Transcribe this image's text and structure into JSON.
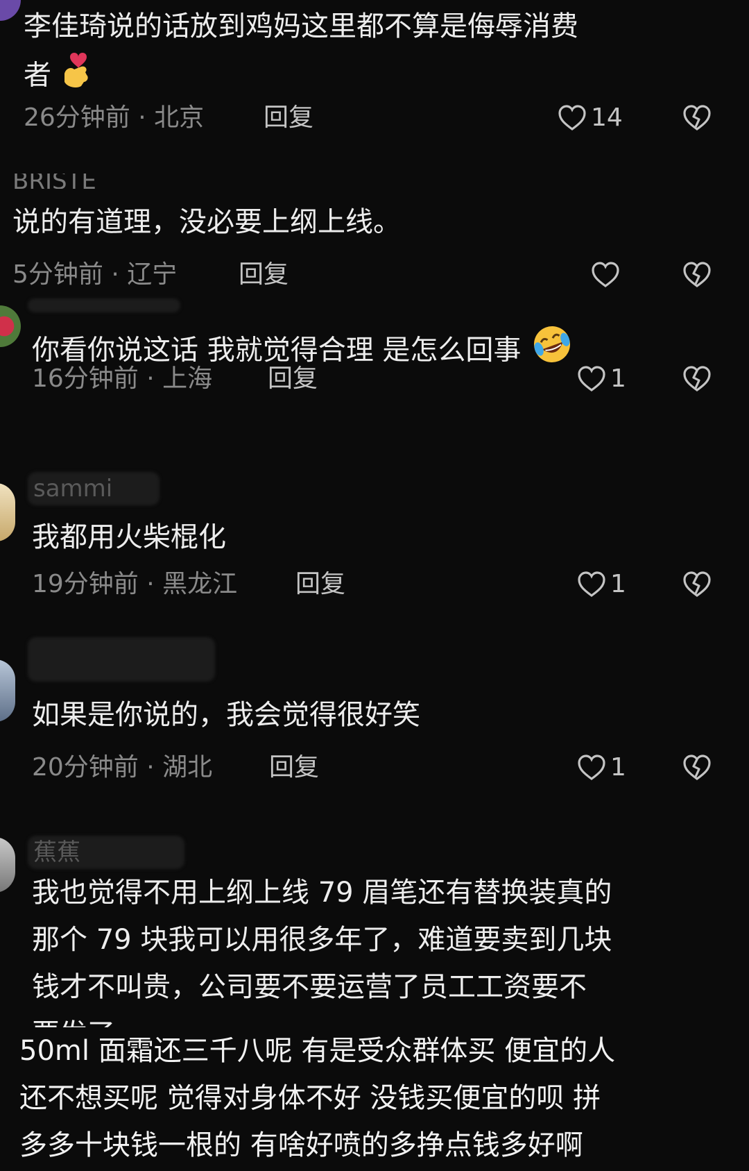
{
  "comments": [
    {
      "lines": [
        "李佳琦说的话放到鸡妈这里都不算是侮辱消费",
        "者"
      ],
      "time": "26分钟前",
      "location": "北京",
      "reply": "回复",
      "likes": "14",
      "emoji": "finger-heart-emoji"
    },
    {
      "username": "BRISTE",
      "lines": [
        "说的有道理，没必要上纲上线。"
      ],
      "time": "5分钟前",
      "location": "辽宁",
      "reply": "回复",
      "likes": ""
    },
    {
      "lines": [
        "你看你说这话 我就觉得合理 是怎么回事"
      ],
      "time": "16分钟前",
      "location": "上海",
      "reply": "回复",
      "likes": "1",
      "emoji": "rofl-emoji"
    },
    {
      "username": "sammi",
      "lines": [
        "我都用火柴棍化"
      ],
      "time": "19分钟前",
      "location": "黑龙江",
      "reply": "回复",
      "likes": "1"
    },
    {
      "lines": [
        "如果是你说的，我会觉得很好笑"
      ],
      "time": "20分钟前",
      "location": "湖北",
      "reply": "回复",
      "likes": "1"
    },
    {
      "username": "蕉蕉",
      "lines": [
        "我也觉得不用上纲上线 79 眉笔还有替换装真的",
        "那个 79 块我可以用很多年了，难道要卖到几块",
        "钱才不叫贵，公司要不要运营了员工工资要不",
        "要发了"
      ]
    }
  ],
  "final_comment": {
    "lines": [
      "50ml 面霜还三千八呢 有是受众群体买 便宜的人",
      "还不想买呢 觉得对身体不好 没钱买便宜的呗 拼",
      "多多十块钱一根的 有啥好喷的多挣点钱多好啊"
    ]
  },
  "separator": "·",
  "colors": {
    "background": "#0b0b0b",
    "text": "#ededed",
    "meta": "#8a8a8a",
    "icon": "#c4c4c4"
  }
}
